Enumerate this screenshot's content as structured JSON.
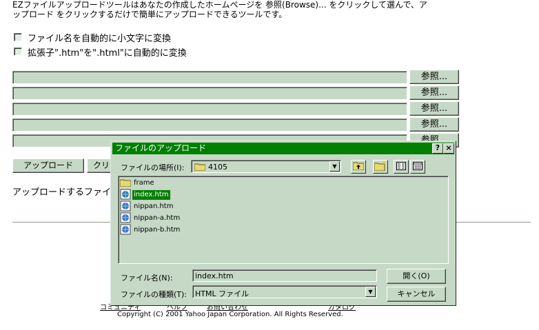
{
  "page": {
    "intro_line1": "EZファイルアップロードツールはあなたの作成したホームページを 参照(Browse)... をクリックして選んで、ア",
    "intro_line2": "ップロード をクリックするだけで簡単にアップロードできるツールです。",
    "options": [
      {
        "label": "ファイル名を自動的に小文字に変換"
      },
      {
        "label": "拡張子\".htm\"を\".html\"に自動的に変換"
      }
    ],
    "browse_label": "参照...",
    "upload_label": "アップロード",
    "clear_label": "クリ",
    "upload_files_label": "アップロードするファイル",
    "footer_links": [
      "コミュニティ",
      "ヘルプ",
      "お問い合わせ",
      "カタログ"
    ],
    "copyright": "Copyright (C) 2001 Yahoo Japan Corporation. All Rights Reserved."
  },
  "dialog": {
    "title": "ファイルのアップロード",
    "help_btn": "?",
    "close_btn": "×",
    "look_in_label": "ファイルの場所(I):",
    "look_in_value": "4105",
    "files": [
      {
        "name": "frame",
        "type": "folder",
        "selected": false
      },
      {
        "name": "index.htm",
        "type": "html",
        "selected": true
      },
      {
        "name": "nippan.htm",
        "type": "html",
        "selected": false
      },
      {
        "name": "nippan-a.htm",
        "type": "html",
        "selected": false
      },
      {
        "name": "nippan-b.htm",
        "type": "html",
        "selected": false
      }
    ],
    "filename_label": "ファイル名(N):",
    "filename_value": "index.htm",
    "filetype_label": "ファイルの種類(T):",
    "filetype_value": "HTML ファイル",
    "open_label": "開く(O)",
    "cancel_label": "キャンセル"
  },
  "colors": {
    "face": "#c6d9c6",
    "titlebar": "#008000",
    "selection": "#008000"
  }
}
